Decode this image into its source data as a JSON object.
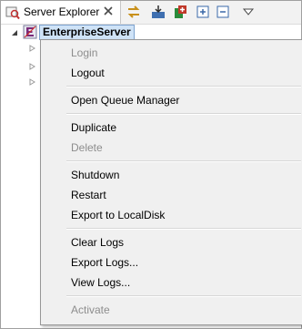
{
  "view": {
    "tab_title": "Server Explorer",
    "toolbar": [
      "sync-icon",
      "import-icon",
      "add-server-icon",
      "expand-all-icon",
      "collapse-all-icon",
      "view-menu-icon"
    ]
  },
  "tree": {
    "root_label": "EnterpriseServer",
    "collapsed_children": 3
  },
  "context_menu": {
    "items": [
      {
        "label": "Login",
        "enabled": false
      },
      {
        "label": "Logout",
        "enabled": true
      },
      {
        "label": "Open Queue Manager",
        "enabled": true
      },
      {
        "label": "Duplicate",
        "enabled": true
      },
      {
        "label": "Delete",
        "enabled": false
      },
      {
        "label": "Shutdown",
        "enabled": true
      },
      {
        "label": "Restart",
        "enabled": true
      },
      {
        "label": "Export to LocalDisk",
        "enabled": true
      },
      {
        "label": "Clear Logs",
        "enabled": true
      },
      {
        "label": "Export Logs...",
        "enabled": true
      },
      {
        "label": "View Logs...",
        "enabled": true
      },
      {
        "label": "Activate",
        "enabled": false
      }
    ]
  },
  "colors": {
    "selection_bg": "#cfe3f7",
    "selection_border": "#7da2ce",
    "menu_bg": "#f0f0f0",
    "disabled_text": "#8d8d8d"
  }
}
